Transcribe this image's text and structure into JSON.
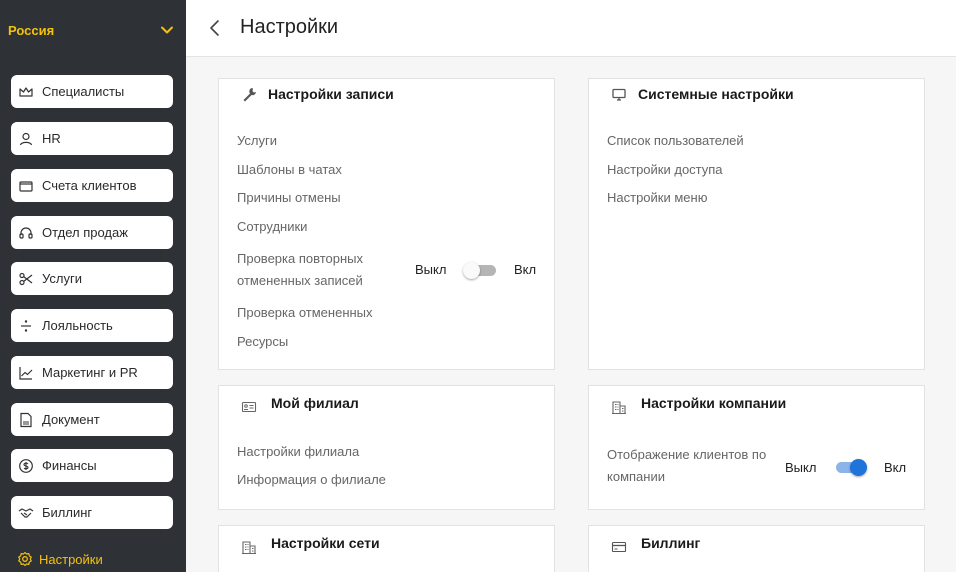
{
  "colors": {
    "sidebar_bg": "#2e3136",
    "accent_yellow": "#f4c20d",
    "toggle_on": "#1e74d8",
    "toggle_off": "#b5b5b5"
  },
  "sidebar": {
    "region": "Россия",
    "items": [
      {
        "label": "Специалисты",
        "icon": "crown-icon"
      },
      {
        "label": "HR",
        "icon": "user-icon"
      },
      {
        "label": "Счета клиентов",
        "icon": "wallet-icon"
      },
      {
        "label": "Отдел продаж",
        "icon": "headset-icon"
      },
      {
        "label": "Услуги",
        "icon": "scissors-icon"
      },
      {
        "label": "Лояльность",
        "icon": "divide-icon"
      },
      {
        "label": "Маркетинг и PR",
        "icon": "chart-line-icon"
      },
      {
        "label": "Документ",
        "icon": "doc-file-icon"
      },
      {
        "label": "Финансы",
        "icon": "dollar-icon"
      },
      {
        "label": "Биллинг",
        "icon": "handshake-icon"
      }
    ],
    "active": {
      "label": "Настройки",
      "icon": "gear-icon"
    }
  },
  "header": {
    "title": "Настройки"
  },
  "cards": {
    "booking": {
      "title": "Настройки записи",
      "links": [
        "Услуги",
        "Шаблоны в чатах",
        "Причины отмены",
        "Сотрудники"
      ],
      "toggle": {
        "line1": "Проверка повторных",
        "line2": "отмененных записей",
        "off": "Выкл",
        "on": "Вкл",
        "state": false
      },
      "links_after": [
        "Проверка отмененных",
        "Ресурсы"
      ]
    },
    "system": {
      "title": "Системные настройки",
      "links": [
        "Список пользователей",
        "Настройки доступа",
        "Настройки меню"
      ]
    },
    "branch": {
      "title": "Мой филиал",
      "links": [
        "Настройки филиала",
        "Информация о филиале"
      ]
    },
    "company": {
      "title": "Настройки компании",
      "toggle": {
        "line1": "Отображение клиентов по",
        "line2": "компании",
        "off": "Выкл",
        "on": "Вкл",
        "state": true
      }
    },
    "network": {
      "title": "Настройки сети"
    },
    "billing": {
      "title": "Биллинг"
    }
  }
}
